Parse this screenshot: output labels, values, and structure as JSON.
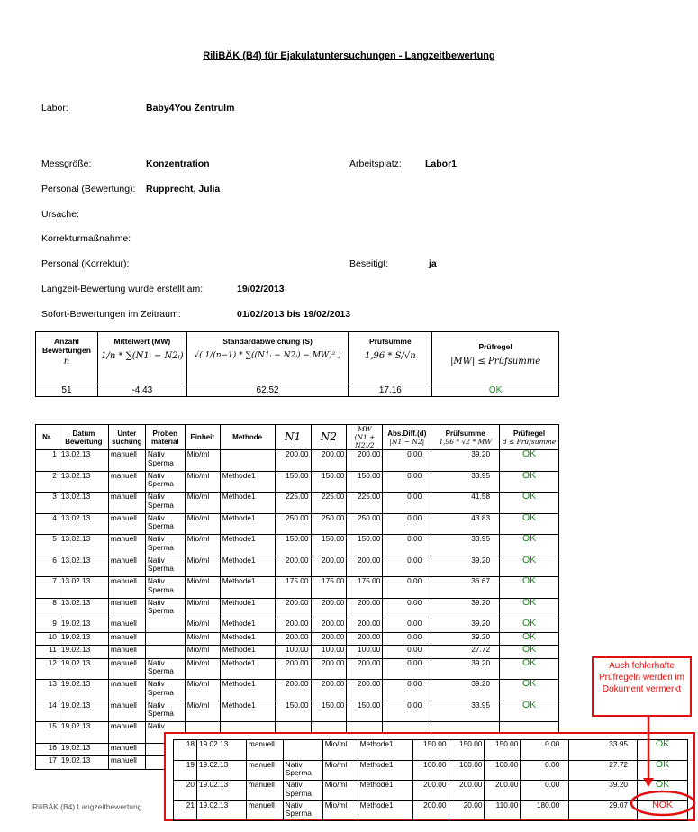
{
  "title": "RiliBÄK (B4) für Ejakulatuntersuchungen - Langzeitbewertung",
  "info": {
    "labor_label": "Labor:",
    "labor_value": "Baby4You Zentrulm",
    "messgroesse_label": "Messgröße:",
    "messgroesse_value": "Konzentration",
    "arbeitsplatz_label": "Arbeitsplatz:",
    "arbeitsplatz_value": "Labor1",
    "personal_bew_label": "Personal (Bewertung):",
    "personal_bew_value": "Rupprecht, Julia",
    "ursache_label": "Ursache:",
    "korrektur_label": "Korrekturmaßnahme:",
    "personal_korr_label": "Personal (Korrektur):",
    "beseitigt_label": "Beseitigt:",
    "beseitigt_value": "ja",
    "erstellt_label": "Langzeit-Bewertung wurde erstellt am:",
    "erstellt_value": "19/02/2013",
    "zeitraum_label": "Sofort-Bewertungen im Zeitraum:",
    "zeitraum_value": "01/02/2013 bis 19/02/2013"
  },
  "summary": {
    "headers": {
      "anzahl": "Anzahl Bewertungen",
      "anzahl_f": "n",
      "mittel": "Mittelwert (MW)",
      "mittel_f": "1/n * ∑(N1ᵢ − N2ᵢ)",
      "std": "Standardabweichung (S)",
      "std_f": "√( 1/(n−1) * ∑((N1ᵢ − N2ᵢ) − MW)² )",
      "pruefsumme": "Prüfsumme",
      "pruefsumme_f": "1,96 * S/√n",
      "pruefregel": "Prüfregel",
      "pruefregel_f": "|MW| ≤ Prüfsumme"
    },
    "values": {
      "anzahl": "51",
      "mittel": "-4.43",
      "std": "62.52",
      "pruefsumme": "17.16",
      "pruefregel": "OK"
    }
  },
  "detail_headers": {
    "nr": "Nr.",
    "datum": "Datum Bewertung",
    "unter": "Unter suchung",
    "proben": "Proben material",
    "einheit": "Einheit",
    "methode": "Methode",
    "n1": "N1",
    "n2": "N2",
    "mw": "MW",
    "mw_f": "(N1 + N2)/2",
    "absdiff": "Abs.Diff.(d)",
    "absdiff_f": "|N1 − N2|",
    "pruefsumme": "Prüfsumme",
    "pruefsumme_f": "1,96 * √2 * MW",
    "pruefregel": "Prüfregel",
    "pruefregel_f": "d ≤ Prüfsumme"
  },
  "rows": [
    {
      "nr": "1",
      "datum": "13.02.13",
      "unter": "manuell",
      "proben": "Nativ Sperma",
      "einheit": "Mio/ml",
      "methode": "",
      "n1": "200.00",
      "n2": "200.00",
      "mw": "200.00",
      "d": "0.00",
      "ps": "39.20",
      "pr": "OK"
    },
    {
      "nr": "2",
      "datum": "13.02.13",
      "unter": "manuell",
      "proben": "Nativ Sperma",
      "einheit": "Mio/ml",
      "methode": "Methode1",
      "n1": "150.00",
      "n2": "150.00",
      "mw": "150.00",
      "d": "0.00",
      "ps": "33.95",
      "pr": "OK"
    },
    {
      "nr": "3",
      "datum": "13.02.13",
      "unter": "manuell",
      "proben": "Nativ Sperma",
      "einheit": "Mio/ml",
      "methode": "Methode1",
      "n1": "225.00",
      "n2": "225.00",
      "mw": "225.00",
      "d": "0.00",
      "ps": "41.58",
      "pr": "OK"
    },
    {
      "nr": "4",
      "datum": "13.02.13",
      "unter": "manuell",
      "proben": "Nativ Sperma",
      "einheit": "Mio/ml",
      "methode": "Methode1",
      "n1": "250.00",
      "n2": "250.00",
      "mw": "250.00",
      "d": "0.00",
      "ps": "43.83",
      "pr": "OK"
    },
    {
      "nr": "5",
      "datum": "13.02.13",
      "unter": "manuell",
      "proben": "Nativ Sperma",
      "einheit": "Mio/ml",
      "methode": "Methode1",
      "n1": "150.00",
      "n2": "150.00",
      "mw": "150.00",
      "d": "0.00",
      "ps": "33.95",
      "pr": "OK"
    },
    {
      "nr": "6",
      "datum": "13.02.13",
      "unter": "manuell",
      "proben": "Nativ Sperma",
      "einheit": "Mio/ml",
      "methode": "Methode1",
      "n1": "200.00",
      "n2": "200.00",
      "mw": "200.00",
      "d": "0.00",
      "ps": "39.20",
      "pr": "OK"
    },
    {
      "nr": "7",
      "datum": "13.02.13",
      "unter": "manuell",
      "proben": "Nativ Sperma",
      "einheit": "Mio/ml",
      "methode": "Methode1",
      "n1": "175.00",
      "n2": "175.00",
      "mw": "175.00",
      "d": "0.00",
      "ps": "36.67",
      "pr": "OK"
    },
    {
      "nr": "8",
      "datum": "13.02.13",
      "unter": "manuell",
      "proben": "Nativ Sperma",
      "einheit": "Mio/ml",
      "methode": "Methode1",
      "n1": "200.00",
      "n2": "200.00",
      "mw": "200.00",
      "d": "0.00",
      "ps": "39.20",
      "pr": "OK"
    },
    {
      "nr": "9",
      "datum": "19.02.13",
      "unter": "manuell",
      "proben": "",
      "einheit": "Mio/ml",
      "methode": "Methode1",
      "n1": "200.00",
      "n2": "200.00",
      "mw": "200.00",
      "d": "0.00",
      "ps": "39.20",
      "pr": "OK"
    },
    {
      "nr": "10",
      "datum": "19.02.13",
      "unter": "manuell",
      "proben": "",
      "einheit": "Mio/ml",
      "methode": "Methode1",
      "n1": "200.00",
      "n2": "200.00",
      "mw": "200.00",
      "d": "0.00",
      "ps": "39.20",
      "pr": "OK"
    },
    {
      "nr": "11",
      "datum": "19.02.13",
      "unter": "manuell",
      "proben": "",
      "einheit": "Mio/ml",
      "methode": "Methode1",
      "n1": "100.00",
      "n2": "100.00",
      "mw": "100.00",
      "d": "0.00",
      "ps": "27.72",
      "pr": "OK"
    },
    {
      "nr": "12",
      "datum": "19.02.13",
      "unter": "manuell",
      "proben": "Nativ Sperma",
      "einheit": "Mio/ml",
      "methode": "Methode1",
      "n1": "200.00",
      "n2": "200.00",
      "mw": "200.00",
      "d": "0.00",
      "ps": "39.20",
      "pr": "OK"
    },
    {
      "nr": "13",
      "datum": "19.02.13",
      "unter": "manuell",
      "proben": "Nativ Sperma",
      "einheit": "Mio/ml",
      "methode": "Methode1",
      "n1": "200.00",
      "n2": "200.00",
      "mw": "200.00",
      "d": "0.00",
      "ps": "39.20",
      "pr": "OK"
    },
    {
      "nr": "14",
      "datum": "19.02.13",
      "unter": "manuell",
      "proben": "Nativ Sperma",
      "einheit": "Mio/ml",
      "methode": "Methode1",
      "n1": "150.00",
      "n2": "150.00",
      "mw": "150.00",
      "d": "0.00",
      "ps": "33.95",
      "pr": "OK"
    },
    {
      "nr": "15",
      "datum": "19.02.13",
      "unter": "manuell",
      "proben": "Nativ",
      "einheit": "",
      "methode": "",
      "n1": "",
      "n2": "",
      "mw": "",
      "d": "",
      "ps": "",
      "pr": ""
    },
    {
      "nr": "16",
      "datum": "19.02.13",
      "unter": "manuell",
      "proben": "",
      "einheit": "",
      "methode": "",
      "n1": "",
      "n2": "",
      "mw": "",
      "d": "",
      "ps": "",
      "pr": ""
    },
    {
      "nr": "17",
      "datum": "19.02.13",
      "unter": "manuell",
      "proben": "",
      "einheit": "",
      "methode": "",
      "n1": "",
      "n2": "",
      "mw": "",
      "d": "",
      "ps": "",
      "pr": ""
    }
  ],
  "overlay_rows": [
    {
      "nr": "18",
      "datum": "19.02.13",
      "unter": "manuell",
      "proben": "",
      "einheit": "Mio/ml",
      "methode": "Methode1",
      "n1": "150.00",
      "n2": "150.00",
      "mw": "150.00",
      "d": "0.00",
      "ps": "33.95",
      "pr": "OK"
    },
    {
      "nr": "19",
      "datum": "19.02.13",
      "unter": "manuell",
      "proben": "Nativ Sperma",
      "einheit": "Mio/ml",
      "methode": "Methode1",
      "n1": "100.00",
      "n2": "100.00",
      "mw": "100.00",
      "d": "0.00",
      "ps": "27.72",
      "pr": "OK"
    },
    {
      "nr": "20",
      "datum": "19.02.13",
      "unter": "manuell",
      "proben": "Nativ Sperma",
      "einheit": "Mio/ml",
      "methode": "Methode1",
      "n1": "200.00",
      "n2": "200.00",
      "mw": "200.00",
      "d": "0.00",
      "ps": "39.20",
      "pr": "OK"
    },
    {
      "nr": "21",
      "datum": "19.02.13",
      "unter": "manuell",
      "proben": "Nativ Sperma",
      "einheit": "Mio/ml",
      "methode": "Methode1",
      "n1": "200.00",
      "n2": "20.00",
      "mw": "110.00",
      "d": "180.00",
      "ps": "29.07",
      "pr": "NOK"
    }
  ],
  "callout": "Auch fehlerhafte Prüfregeln werden im Dokument vermerkt",
  "footer": "RiliBÄK (B4) Langzeitbewertung",
  "colors": {
    "ok": "#1e8a1e",
    "nok": "#e01010",
    "highlight": "#e01010"
  }
}
